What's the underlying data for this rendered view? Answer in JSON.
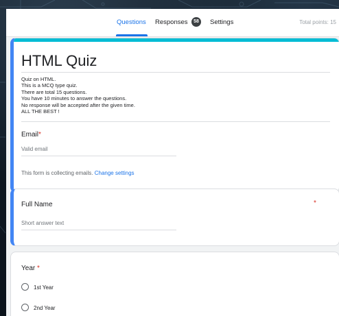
{
  "tabs": [
    {
      "label": "Questions",
      "active": true
    },
    {
      "label": "Responses",
      "active": false,
      "badge": "58"
    },
    {
      "label": "Settings",
      "active": false
    }
  ],
  "total_points": "Total points: 15",
  "form": {
    "title": "HTML Quiz",
    "description_lines": [
      "Quiz on HTML.",
      "This is a MCQ type quiz.",
      "There are total 15 questions.",
      "You have 10 minutes to answer the questions.",
      "No response will be accepted after the given time.",
      "ALL THE BEST !"
    ],
    "email": {
      "label": "Email",
      "required_mark": "*",
      "placeholder": "Valid email",
      "collect_note": "This form is collecting emails.",
      "change_settings": "Change settings"
    }
  },
  "questions": [
    {
      "label": "Full Name",
      "required_mark": "*",
      "placeholder": "Short answer text"
    },
    {
      "label": "Year",
      "required_mark": "*",
      "options": [
        "1st Year",
        "2nd Year"
      ]
    }
  ],
  "colors": {
    "accent": "#1a73e8",
    "header_strip": "#00bcd4",
    "selected_border": "#4285f4",
    "required": "#d93025"
  }
}
